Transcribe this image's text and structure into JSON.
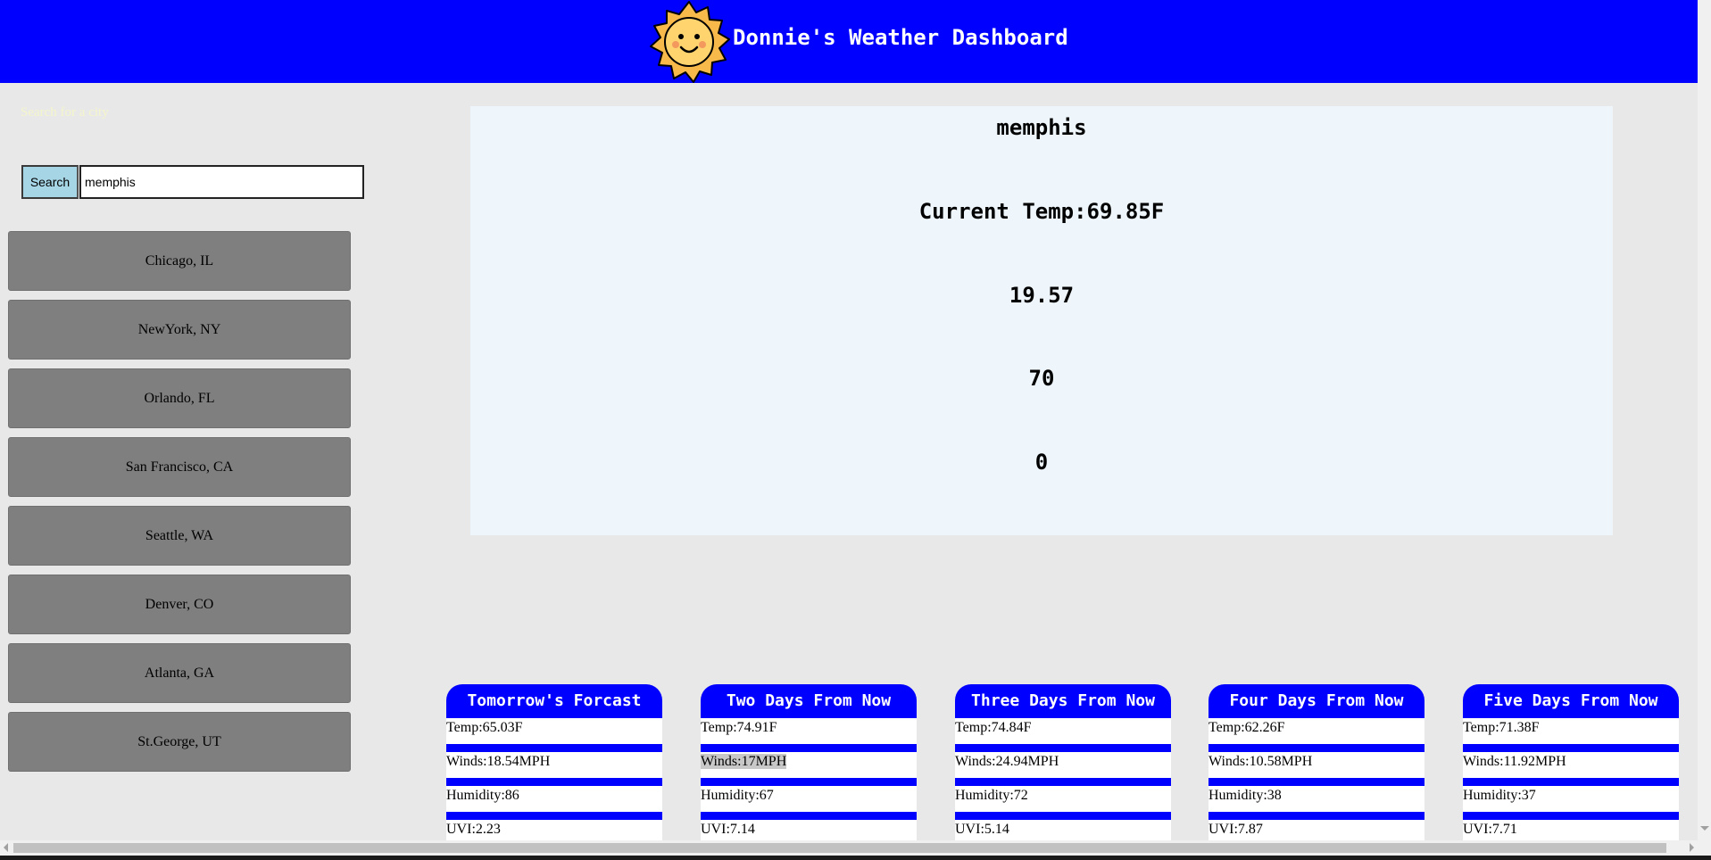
{
  "header": {
    "title": "Donnie's Weather Dashboard",
    "logo_icon": "smiling-sun-icon",
    "background": "#0000ff"
  },
  "search": {
    "label": "Search for a city",
    "button_label": "Search",
    "input_value": "memphis"
  },
  "cities": [
    {
      "label": "Chicago, IL"
    },
    {
      "label": "NewYork, NY"
    },
    {
      "label": "Orlando, FL"
    },
    {
      "label": "San Francisco, CA"
    },
    {
      "label": "Seattle, WA"
    },
    {
      "label": "Denver, CO"
    },
    {
      "label": "Atlanta, GA"
    },
    {
      "label": "St.George, UT"
    }
  ],
  "current": {
    "city": "memphis",
    "temp": "Current Temp:69.85F",
    "wind": "19.57",
    "humidity": "70",
    "uvi": "0"
  },
  "forecast": [
    {
      "title": "Tomorrow's Forcast",
      "temp": "Temp:65.03F",
      "winds": "Winds:18.54MPH",
      "humidity": "Humidity:86",
      "uvi": "UVI:2.23"
    },
    {
      "title": "Two Days From Now",
      "temp": "Temp:74.91F",
      "winds": "Winds:17MPH",
      "humidity": "Humidity:67",
      "uvi": "UVI:7.14"
    },
    {
      "title": "Three Days From Now",
      "temp": "Temp:74.84F",
      "winds": "Winds:24.94MPH",
      "humidity": "Humidity:72",
      "uvi": "UVI:5.14"
    },
    {
      "title": "Four Days From Now",
      "temp": "Temp:62.26F",
      "winds": "Winds:10.58MPH",
      "humidity": "Humidity:38",
      "uvi": "UVI:7.87"
    },
    {
      "title": "Five Days From Now",
      "temp": "Temp:71.38F",
      "winds": "Winds:11.92MPH",
      "humidity": "Humidity:37",
      "uvi": "UVI:7.71"
    }
  ],
  "colors": {
    "accent": "#0000ff",
    "city_button": "#7f7f7f",
    "search_button": "#a6d5e6",
    "panel": "#eef6fc"
  }
}
